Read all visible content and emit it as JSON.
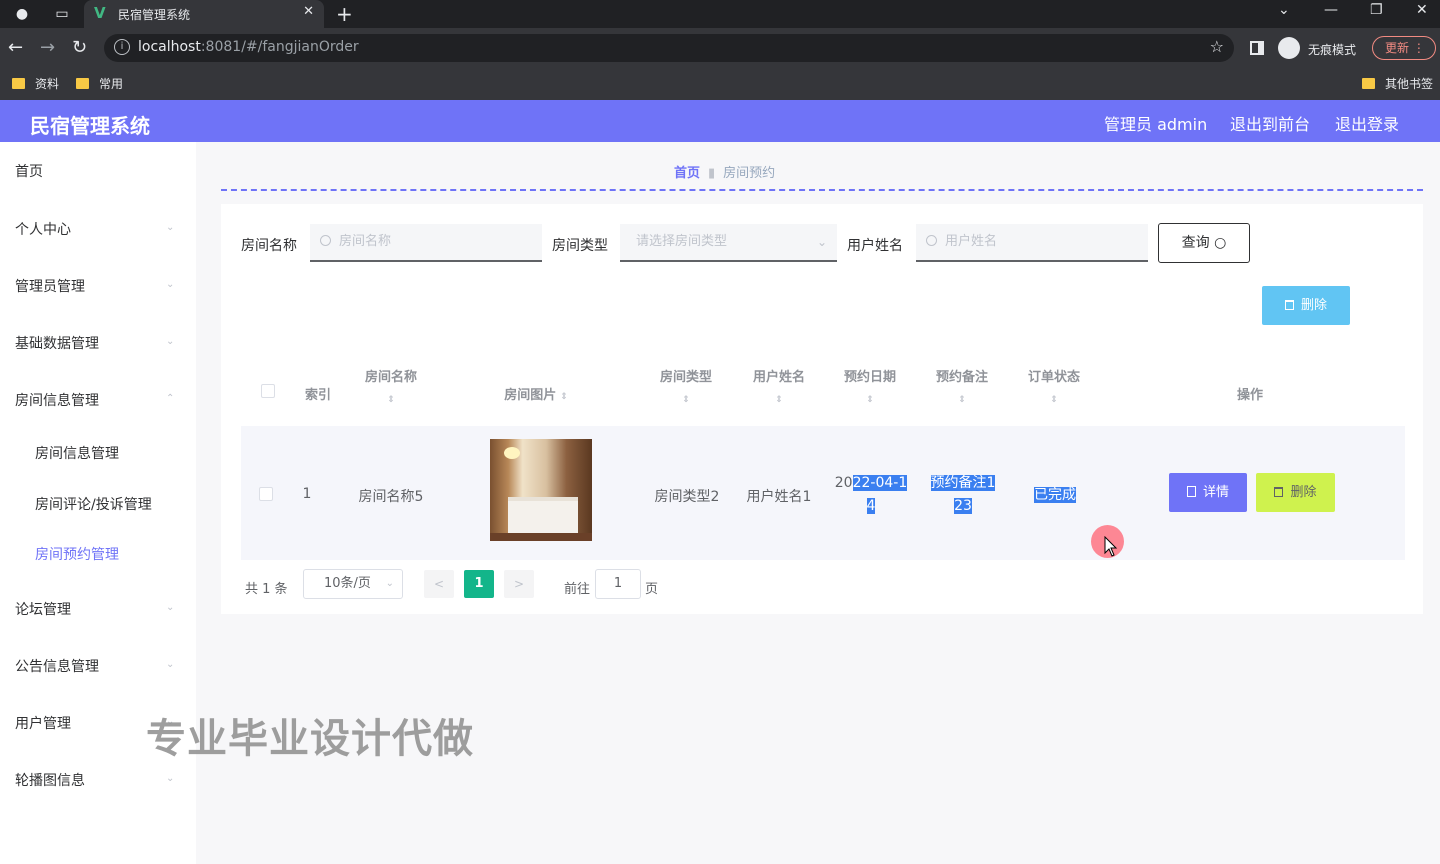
{
  "browser": {
    "tab_title": "民宿管理系统",
    "url_host": "localhost",
    "url_rest": ":8081/#/fangjianOrder",
    "incognito_label": "无痕模式",
    "update_label": "更新",
    "bookmarks": [
      "资料",
      "常用"
    ],
    "other_bookmarks": "其他书签"
  },
  "header": {
    "title": "民宿管理系统",
    "admin_label": "管理员 admin",
    "to_frontend": "退出到前台",
    "logout": "退出登录",
    "accent_color": "#6f73f7"
  },
  "sidebar": {
    "items": [
      {
        "label": "首页"
      },
      {
        "label": "个人中心"
      },
      {
        "label": "管理员管理"
      },
      {
        "label": "基础数据管理"
      },
      {
        "label": "房间信息管理"
      },
      {
        "label": "论坛管理"
      },
      {
        "label": "公告信息管理"
      },
      {
        "label": "用户管理"
      },
      {
        "label": "轮播图信息"
      }
    ],
    "subitems": [
      {
        "label": "房间信息管理",
        "active": false
      },
      {
        "label": "房间评论/投诉管理",
        "active": false
      },
      {
        "label": "房间预约管理",
        "active": true
      }
    ]
  },
  "breadcrumb": {
    "home": "首页",
    "current": "房间预约"
  },
  "filters": {
    "room_name_label": "房间名称",
    "room_name_placeholder": "房间名称",
    "room_type_label": "房间类型",
    "room_type_placeholder": "请选择房间类型",
    "user_name_label": "用户姓名",
    "user_name_placeholder": "用户姓名",
    "query_label": "查询",
    "delete_label": "删除"
  },
  "table": {
    "columns": [
      "索引",
      "房间名称",
      "房间图片",
      "房间类型",
      "用户姓名",
      "预约日期",
      "预约备注",
      "订单状态",
      "操作"
    ],
    "rows": [
      {
        "index": "1",
        "room_name": "房间名称5",
        "room_type": "房间类型2",
        "user_name": "用户姓名1",
        "date_a": "20",
        "date_b": "22-04-1",
        "date_c": "4",
        "note_a": "预约备注1",
        "note_b": "23",
        "status": "已完成",
        "detail_label": "详情",
        "delete_label": "删除"
      }
    ]
  },
  "pagination": {
    "total": "共 1 条",
    "page_size": "10条/页",
    "prev": "<",
    "current": "1",
    "next": ">",
    "goto_label": "前往",
    "goto_value": "1",
    "goto_unit": "页"
  },
  "watermark": "专业毕业设计代做"
}
